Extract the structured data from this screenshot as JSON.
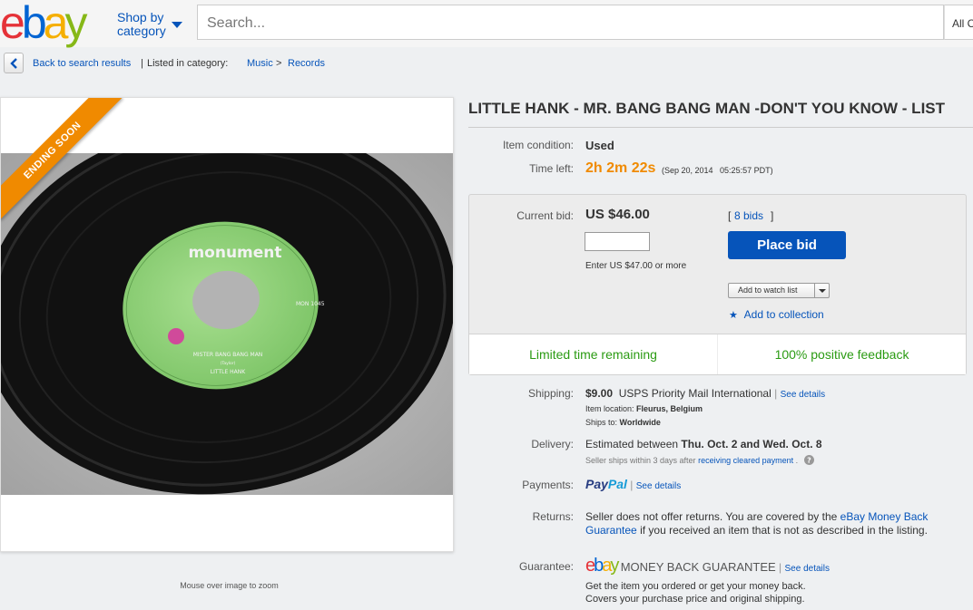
{
  "header": {
    "logo_letters": [
      "e",
      "b",
      "a",
      "y"
    ],
    "shop_by_line1": "Shop by",
    "shop_by_line2": "category",
    "search_placeholder": "Search...",
    "category_select": "All C"
  },
  "breadcrumb": {
    "back_label": "Back to search results",
    "separator": "|",
    "listed_in": "Listed in category:",
    "cat1": "Music",
    "arrow": ">",
    "cat2": "Records"
  },
  "image_panel": {
    "ribbon": "ENDING SOON",
    "label_brand": "monument",
    "label_song": "MISTER BANG BANG MAN",
    "label_composer": "(Taylor)",
    "label_artist": "LITTLE HANK",
    "label_catalog": "MON 1045",
    "zoom_hint": "Mouse over image to zoom"
  },
  "item": {
    "title": "LITTLE HANK - MR. BANG BANG MAN -DON'T YOU KNOW - LIST",
    "condition_label": "Item condition:",
    "condition_value": "Used",
    "time_left_label": "Time left:",
    "time_left_value": "2h 2m 22s",
    "end_date": "(Sep 20, 2014   05:25:57 PDT)"
  },
  "bid_box": {
    "current_bid_label": "Current bid:",
    "current_bid_value": "US $46.00",
    "bids_open": "[",
    "bids_count": "8 bids",
    "bids_close": "]",
    "place_bid": "Place bid",
    "bid_hint": "Enter US $47.00 or more",
    "watch_list": "Add to watch list",
    "add_collection": "Add to collection",
    "highlight_left": "Limited time remaining",
    "highlight_right": "100% positive feedback"
  },
  "shipping": {
    "label": "Shipping:",
    "cost": "$9.00",
    "service": "USPS Priority Mail International",
    "see_details": "See details",
    "location_label": "Item location:",
    "location_value": "Fleurus, Belgium",
    "ships_to_label": "Ships to:",
    "ships_to_value": "Worldwide"
  },
  "delivery": {
    "label": "Delivery:",
    "text": "Estimated between",
    "dates": "Thu. Oct. 2 and Wed. Oct. 8",
    "note": "Seller ships within 3 days after",
    "note_link": "receiving cleared payment",
    "note_end": "."
  },
  "payments": {
    "label": "Payments:",
    "paypal_part1": "Pay",
    "paypal_part2": "Pal",
    "see_details": "See details"
  },
  "returns": {
    "label": "Returns:",
    "line1_text": "Seller does not offer returns. You are covered by the",
    "line1_link": "eBay Money",
    "line2_link": "Back Guarantee",
    "line2_text": "if you received an item that is not as described in the",
    "line3_text": "listing."
  },
  "guarantee": {
    "label": "Guarantee:",
    "mbg": "MONEY BACK GUARANTEE",
    "see_details": "See details",
    "line1": "Get the item you ordered or get your money back.",
    "line2": "Covers your purchase price and original shipping."
  },
  "colors": {
    "ebay_red": "#e53238",
    "ebay_blue": "#0654ba",
    "ebay_yellow": "#f5af02",
    "ebay_green": "#86b817",
    "accent_orange": "#f08a00",
    "positive_green": "#2b9b13"
  }
}
